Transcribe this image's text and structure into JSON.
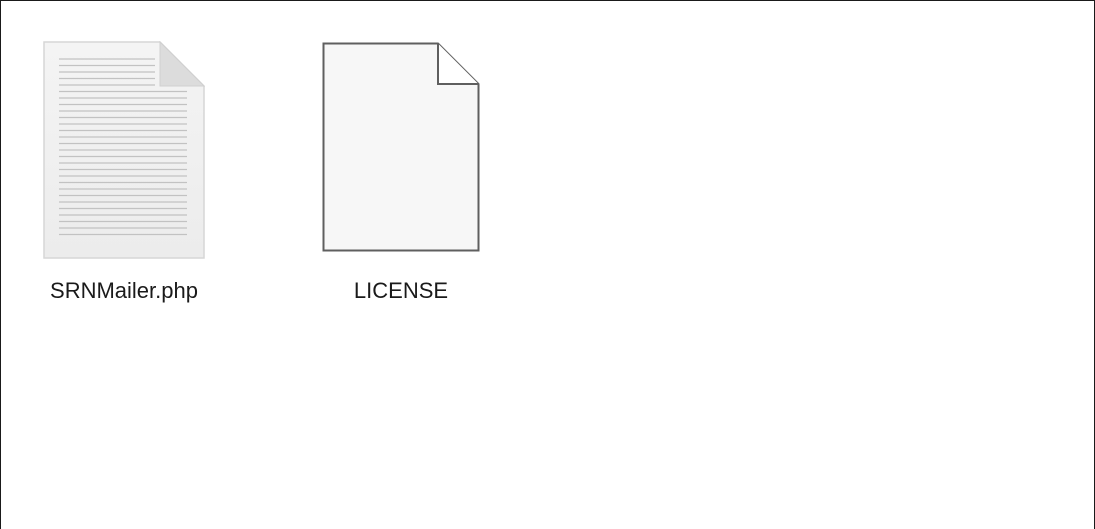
{
  "files": [
    {
      "name": "SRNMailer.php",
      "icon": "text-document-icon"
    },
    {
      "name": "LICENSE",
      "icon": "blank-document-icon"
    }
  ]
}
